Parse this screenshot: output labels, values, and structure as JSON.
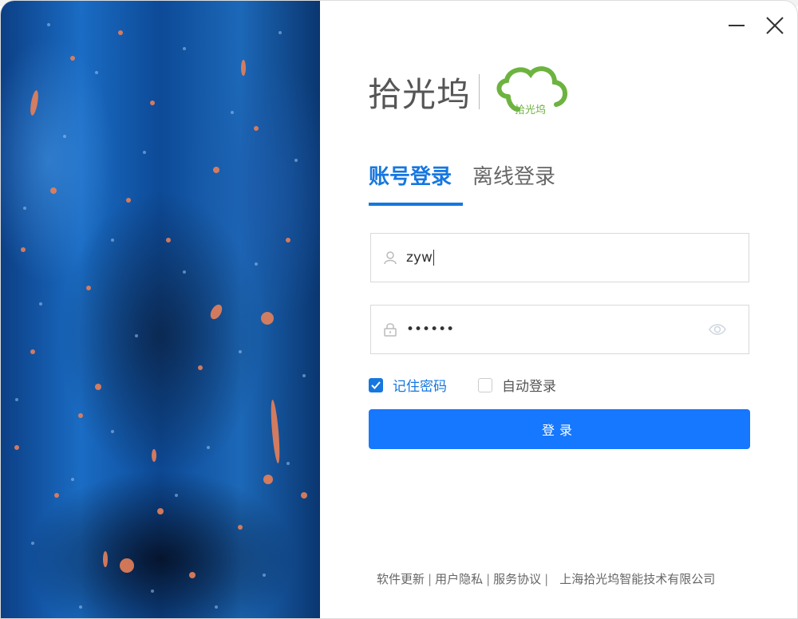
{
  "logo": {
    "name": "拾光坞",
    "cloud_text": "拾光坞"
  },
  "tabs": [
    {
      "label": "账号登录"
    },
    {
      "label": "离线登录"
    }
  ],
  "username": {
    "value": "zyw"
  },
  "password": {
    "masked_value": "••••••"
  },
  "options": {
    "remember_label": "记住密码",
    "remember_checked": true,
    "autologin_label": "自动登录",
    "autologin_checked": false
  },
  "login_button": {
    "label": "登录"
  },
  "footer": {
    "links": [
      "软件更新",
      "用户隐私",
      "服务协议"
    ],
    "separator": "|",
    "company": "上海拾光坞智能技术有限公司"
  },
  "colors": {
    "accent": "#1677e0",
    "button": "#1677ff",
    "logo_green": "#6db33f"
  }
}
